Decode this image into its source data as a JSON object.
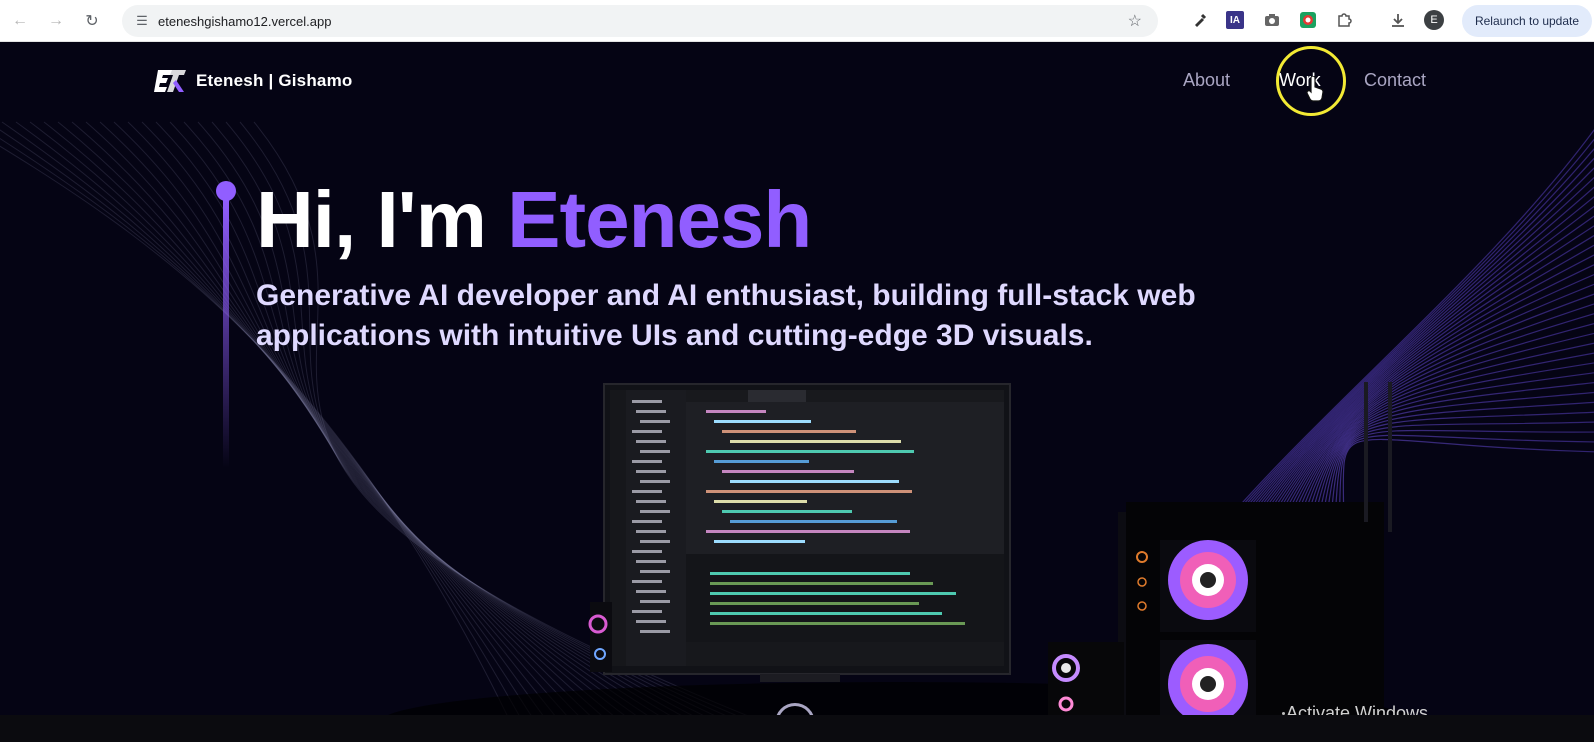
{
  "browser": {
    "url": "eteneshgishamo12.vercel.app",
    "relaunch_label": "Relaunch to update",
    "profile_initial": "E",
    "icons": [
      "back-icon",
      "forward-icon",
      "reload-icon",
      "site-settings-icon",
      "bookmark-star-icon",
      "eyedropper-icon",
      "ia-extension-icon",
      "camera-icon",
      "record-extension-icon",
      "extensions-puzzle-icon",
      "download-icon",
      "profile-avatar-icon"
    ]
  },
  "site": {
    "logo_text": "Etenesh | Gishamo",
    "nav": [
      {
        "label": "About"
      },
      {
        "label": "Work"
      },
      {
        "label": "Contact"
      }
    ],
    "hero": {
      "greeting": "Hi, I'm",
      "name": "Etenesh",
      "subtitle": "Generative AI developer and AI enthusiast, building full-stack web applications with intuitive UIs and cutting-edge 3D visuals."
    }
  },
  "os": {
    "watermark": "Activate Windows"
  },
  "colors": {
    "accent": "#915eff",
    "page_bg": "#050414",
    "nav_text": "#aaa6c3",
    "cursor_highlight": "#f3ea34"
  }
}
